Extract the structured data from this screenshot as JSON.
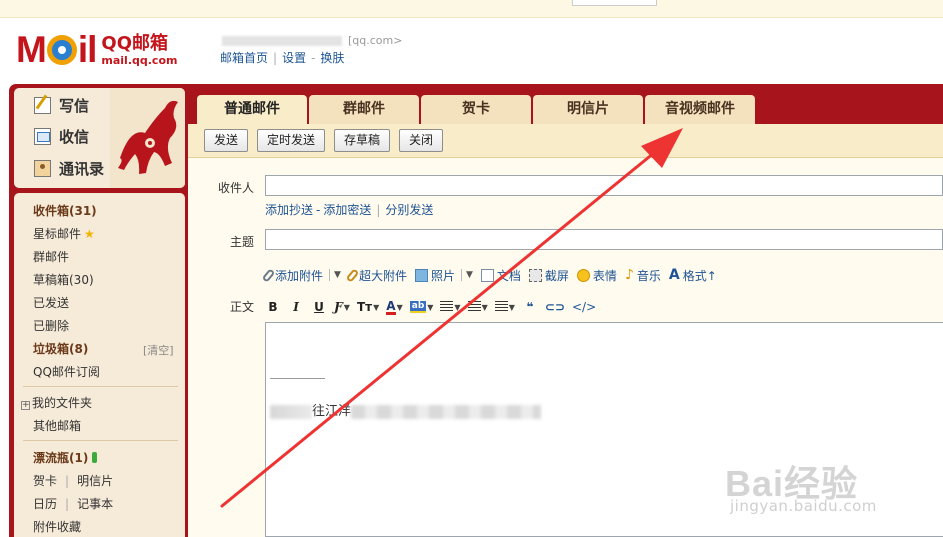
{
  "header": {
    "logo_text": "M",
    "logo_text2": "il",
    "logo_cn": "QQ邮箱",
    "logo_url": "mail.qq.com",
    "account_suffix": "[qq.com>",
    "links": [
      "邮箱首页",
      "设置",
      "换肤"
    ]
  },
  "sidebar": {
    "actions": [
      "写信",
      "收信",
      "通讯录"
    ],
    "inbox": "收件箱(31)",
    "starred": "星标邮件",
    "starred_icon": "star-icon",
    "group_mail": "群邮件",
    "drafts": "草稿箱(30)",
    "sent": "已发送",
    "deleted": "已删除",
    "spam": "垃圾箱(8)",
    "spam_clear": "[清空]",
    "subscriptions": "QQ邮件订阅",
    "my_folders": "我的文件夹",
    "other_mail": "其他邮箱",
    "drift_bottle": "漂流瓶(1)",
    "cards": "贺卡",
    "postcards": "明信片",
    "calendar": "日历",
    "notes": "记事本",
    "attachments": "附件收藏"
  },
  "tabs": [
    "普通邮件",
    "群邮件",
    "贺卡",
    "明信片",
    "音视频邮件"
  ],
  "toolbar": {
    "send": "发送",
    "scheduled_send": "定时发送",
    "save_draft": "存草稿",
    "close": "关闭"
  },
  "compose": {
    "to_label": "收件人",
    "to_value": "",
    "add_cc": "添加抄送",
    "add_bcc": "添加密送",
    "send_separately": "分别发送",
    "subject_label": "主题",
    "subject_value": "",
    "attach_items": [
      "添加附件",
      "超大附件",
      "照片",
      "文档",
      "截屏",
      "表情",
      "音乐",
      "格式↑"
    ],
    "body_label": "正文",
    "signature_visible": "往江洋",
    "format_buttons": [
      "B",
      "I",
      "U"
    ],
    "code_button": "</>"
  },
  "watermark": {
    "main": "Bai经验",
    "sub": "jingyan.baidu.com"
  },
  "colors": {
    "frame": "#a8141b",
    "link": "#1e5494",
    "arrow": "#ee3333"
  }
}
